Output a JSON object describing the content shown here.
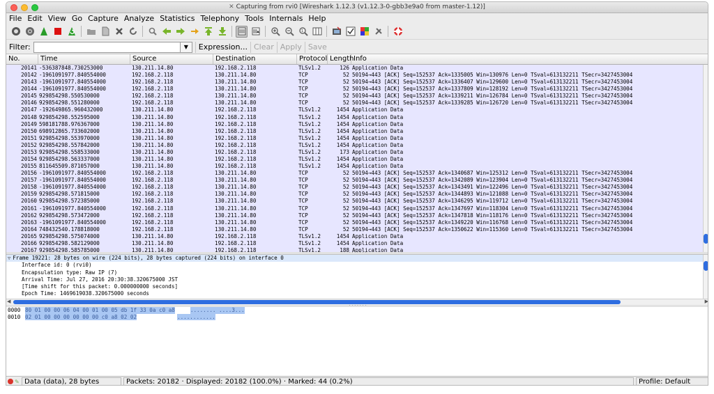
{
  "window": {
    "title": "Capturing from rvi0   [Wireshark 1.12.3  (v1.12.3-0-gbb3e9a0 from master-1.12)]"
  },
  "menu": [
    "File",
    "Edit",
    "View",
    "Go",
    "Capture",
    "Analyze",
    "Statistics",
    "Telephony",
    "Tools",
    "Internals",
    "Help"
  ],
  "toolbar": {
    "icons": [
      "interfaces-icon",
      "options-icon",
      "start-capture-icon",
      "stop-capture-icon",
      "restart-capture-icon",
      "open-file-icon",
      "save-file-icon",
      "close-file-icon",
      "reload-icon",
      "find-icon",
      "back-icon",
      "forward-icon",
      "go-to-packet-icon",
      "first-packet-icon",
      "last-packet-icon",
      "colorize-icon",
      "autoscroll-icon",
      "zoom-in-icon",
      "zoom-out-icon",
      "normal-size-icon",
      "resize-columns-icon",
      "capture-filters-icon",
      "display-filters-icon",
      "coloring-rules-icon",
      "preferences-icon",
      "help-icon"
    ]
  },
  "filter": {
    "label": "Filter:",
    "value": "",
    "expression": "Expression...",
    "clear": "Clear",
    "apply": "Apply",
    "save": "Save"
  },
  "packet_list": {
    "columns": {
      "no": "No.",
      "time": "Time",
      "source": "Source",
      "destination": "Destination",
      "protocol": "Protocol",
      "length": "Length",
      "info": "Info"
    },
    "rows": [
      {
        "no": "20141",
        "time": "-536387848.730253000",
        "src": "130.211.14.80",
        "dst": "192.168.2.118",
        "proto": "TLSv1.2",
        "len": "126",
        "info": "Application Data"
      },
      {
        "no": "20142",
        "time": "-1961091977.840554000",
        "src": "192.168.2.118",
        "dst": "130.211.14.80",
        "proto": "TCP",
        "len": "52",
        "info": "50194→443 [ACK] Seq=152537 Ack=1335005 Win=130976 Len=0 TSval=613132211 TSecr=3427453004"
      },
      {
        "no": "20143",
        "time": "-1961091977.840554000",
        "src": "192.168.2.118",
        "dst": "130.211.14.80",
        "proto": "TCP",
        "len": "52",
        "info": "50194→443 [ACK] Seq=152537 Ack=1336407 Win=129600 Len=0 TSval=613132211 TSecr=3427453004"
      },
      {
        "no": "20144",
        "time": "-1961091977.840554000",
        "src": "192.168.2.118",
        "dst": "130.211.14.80",
        "proto": "TCP",
        "len": "52",
        "info": "50194→443 [ACK] Seq=152537 Ack=1337809 Win=128192 Len=0 TSval=613132211 TSecr=3427453004"
      },
      {
        "no": "20145",
        "time": "929854298.550530000",
        "src": "192.168.2.118",
        "dst": "130.211.14.80",
        "proto": "TCP",
        "len": "52",
        "info": "50194→443 [ACK] Seq=152537 Ack=1339211 Win=126784 Len=0 TSval=613132211 TSecr=3427453004"
      },
      {
        "no": "20146",
        "time": "929854298.551280000",
        "src": "192.168.2.118",
        "dst": "130.211.14.80",
        "proto": "TCP",
        "len": "52",
        "info": "50194→443 [ACK] Seq=152537 Ack=1339285 Win=126720 Len=0 TSval=613132211 TSecr=3427453004"
      },
      {
        "no": "20147",
        "time": "-192649865.960432000",
        "src": "130.211.14.80",
        "dst": "192.168.2.118",
        "proto": "TLSv1.2",
        "len": "1454",
        "info": "Application Data"
      },
      {
        "no": "20148",
        "time": "929854298.552595000",
        "src": "130.211.14.80",
        "dst": "192.168.2.118",
        "proto": "TLSv1.2",
        "len": "1454",
        "info": "Application Data"
      },
      {
        "no": "20149",
        "time": "598181788.976367000",
        "src": "130.211.14.80",
        "dst": "192.168.2.118",
        "proto": "TLSv1.2",
        "len": "1454",
        "info": "Application Data"
      },
      {
        "no": "20150",
        "time": "698912865.733602000",
        "src": "130.211.14.80",
        "dst": "192.168.2.118",
        "proto": "TLSv1.2",
        "len": "1454",
        "info": "Application Data"
      },
      {
        "no": "20151",
        "time": "929854298.553970000",
        "src": "130.211.14.80",
        "dst": "192.168.2.118",
        "proto": "TLSv1.2",
        "len": "1454",
        "info": "Application Data"
      },
      {
        "no": "20152",
        "time": "929854298.557842000",
        "src": "130.211.14.80",
        "dst": "192.168.2.118",
        "proto": "TLSv1.2",
        "len": "1454",
        "info": "Application Data"
      },
      {
        "no": "20153",
        "time": "929854298.558533000",
        "src": "130.211.14.80",
        "dst": "192.168.2.118",
        "proto": "TLSv1.2",
        "len": "173",
        "info": "Application Data"
      },
      {
        "no": "20154",
        "time": "929854298.563337000",
        "src": "130.211.14.80",
        "dst": "192.168.2.118",
        "proto": "TLSv1.2",
        "len": "1454",
        "info": "Application Data"
      },
      {
        "no": "20155",
        "time": "811645509.871057000",
        "src": "130.211.14.80",
        "dst": "192.168.2.118",
        "proto": "TLSv1.2",
        "len": "1454",
        "info": "Application Data"
      },
      {
        "no": "20156",
        "time": "-1961091977.840554000",
        "src": "192.168.2.118",
        "dst": "130.211.14.80",
        "proto": "TCP",
        "len": "52",
        "info": "50194→443 [ACK] Seq=152537 Ack=1340687 Win=125312 Len=0 TSval=613132211 TSecr=3427453004"
      },
      {
        "no": "20157",
        "time": "-1961091977.840554000",
        "src": "192.168.2.118",
        "dst": "130.211.14.80",
        "proto": "TCP",
        "len": "52",
        "info": "50194→443 [ACK] Seq=152537 Ack=1342089 Win=123904 Len=0 TSval=613132211 TSecr=3427453004"
      },
      {
        "no": "20158",
        "time": "-1961091977.840554000",
        "src": "192.168.2.118",
        "dst": "130.211.14.80",
        "proto": "TCP",
        "len": "52",
        "info": "50194→443 [ACK] Seq=152537 Ack=1343491 Win=122496 Len=0 TSval=613132211 TSecr=3427453004"
      },
      {
        "no": "20159",
        "time": "929854298.571815000",
        "src": "192.168.2.118",
        "dst": "130.211.14.80",
        "proto": "TCP",
        "len": "52",
        "info": "50194→443 [ACK] Seq=152537 Ack=1344893 Win=121088 Len=0 TSval=613132211 TSecr=3427453004"
      },
      {
        "no": "20160",
        "time": "929854298.572385000",
        "src": "192.168.2.118",
        "dst": "130.211.14.80",
        "proto": "TCP",
        "len": "52",
        "info": "50194→443 [ACK] Seq=152537 Ack=1346295 Win=119712 Len=0 TSval=613132211 TSecr=3427453004"
      },
      {
        "no": "20161",
        "time": "-1961091977.840554000",
        "src": "192.168.2.118",
        "dst": "130.211.14.80",
        "proto": "TCP",
        "len": "52",
        "info": "50194→443 [ACK] Seq=152537 Ack=1347697 Win=118304 Len=0 TSval=613132211 TSecr=3427453004"
      },
      {
        "no": "20162",
        "time": "929854298.573472000",
        "src": "192.168.2.118",
        "dst": "130.211.14.80",
        "proto": "TCP",
        "len": "52",
        "info": "50194→443 [ACK] Seq=152537 Ack=1347818 Win=118176 Len=0 TSval=613132211 TSecr=3427453004"
      },
      {
        "no": "20163",
        "time": "-1961091977.840554000",
        "src": "192.168.2.118",
        "dst": "130.211.14.80",
        "proto": "TCP",
        "len": "52",
        "info": "50194→443 [ACK] Seq=152537 Ack=1349220 Win=116768 Len=0 TSval=613132211 TSecr=3427453004"
      },
      {
        "no": "20164",
        "time": "748432540.178818000",
        "src": "192.168.2.118",
        "dst": "130.211.14.80",
        "proto": "TCP",
        "len": "52",
        "info": "50194→443 [ACK] Seq=152537 Ack=1350622 Win=115360 Len=0 TSval=613132211 TSecr=3427453004"
      },
      {
        "no": "20165",
        "time": "929854298.575074000",
        "src": "130.211.14.80",
        "dst": "192.168.2.118",
        "proto": "TLSv1.2",
        "len": "1454",
        "info": "Application Data"
      },
      {
        "no": "20166",
        "time": "929854298.582129000",
        "src": "130.211.14.80",
        "dst": "192.168.2.118",
        "proto": "TLSv1.2",
        "len": "1454",
        "info": "Application Data"
      },
      {
        "no": "20167",
        "time": "929854298.585785000",
        "src": "130.211.14.80",
        "dst": "192.168.2.118",
        "proto": "TLSv1.2",
        "len": "188",
        "info": "Application Data"
      }
    ]
  },
  "details": {
    "header": "Frame 19221: 28 bytes on wire (224 bits), 28 bytes captured (224 bits) on interface 0",
    "lines": [
      "Interface id: 0 (rvi0)",
      "Encapsulation type: Raw IP (7)",
      "Arrival Time: Jul 27, 2016 20:30:38.320675000 JST",
      "[Time shift for this packet: 0.000000000 seconds]",
      "Epoch Time: 1469619038.320675000 seconds"
    ]
  },
  "bytes": {
    "lines": [
      {
        "offset": "0000",
        "hex": "80 01 00 00 06 04 00 01  00 05 db 1f 33 0a c0 a8",
        "ascii": "........ ....3..."
      },
      {
        "offset": "0010",
        "hex": "02 01 00 00 00 00 00 00  c0 a8 02 02",
        "ascii": "............"
      }
    ]
  },
  "status": {
    "field": "Data (data), 28 bytes",
    "packets": "Packets: 20182 · Displayed: 20182 (100.0%)  · Marked: 44 (0.2%)",
    "profile": "Profile: Default"
  },
  "colors": {
    "row_background": "#e7e6ff",
    "selection_blue": "#2e6de0",
    "bytes_highlight": "#a9c7f3"
  }
}
